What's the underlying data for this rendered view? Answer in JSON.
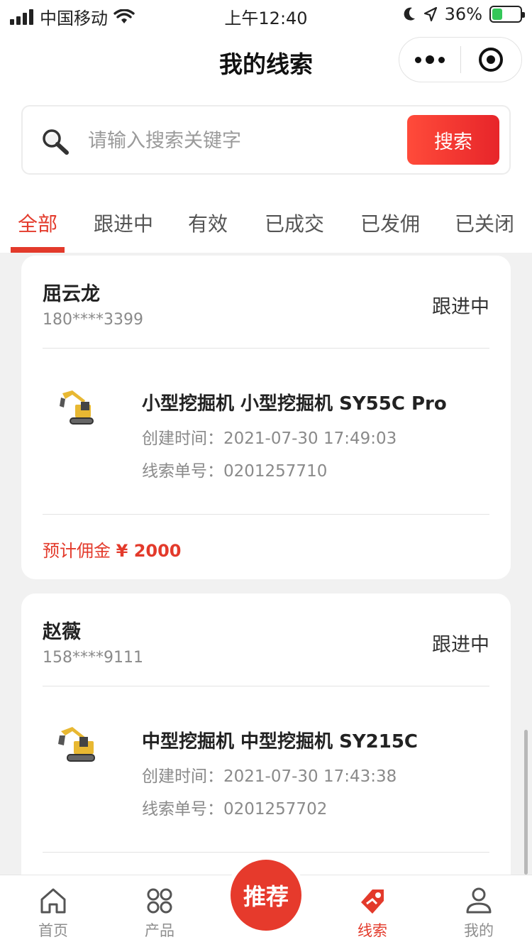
{
  "status_bar": {
    "carrier": "中国移动",
    "time": "上午12:40",
    "battery": "36%",
    "battery_level": 0.36
  },
  "nav": {
    "title": "我的线索"
  },
  "search": {
    "placeholder": "请输入搜索关键字",
    "value": "",
    "button": "搜索"
  },
  "tabs": [
    {
      "label": "全部",
      "active": true
    },
    {
      "label": "跟进中",
      "active": false
    },
    {
      "label": "有效",
      "active": false
    },
    {
      "label": "已成交",
      "active": false
    },
    {
      "label": "已发佣",
      "active": false
    },
    {
      "label": "已关闭",
      "active": false
    }
  ],
  "leads": [
    {
      "name": "屈云龙",
      "phone": "180****3399",
      "status": "跟进中",
      "product": "小型挖掘机 小型挖掘机 SY55C Pro",
      "created_label": "创建时间：",
      "created": "2021-07-30 17:49:03",
      "order_label": "线索单号：",
      "order_no": "0201257710",
      "commission_label": "预计佣金",
      "commission": "¥ 2000"
    },
    {
      "name": "赵薇",
      "phone": "158****9111",
      "status": "跟进中",
      "product": "中型挖掘机 中型挖掘机 SY215C",
      "created_label": "创建时间：",
      "created": "2021-07-30 17:43:38",
      "order_label": "线索单号：",
      "order_no": "0201257702"
    }
  ],
  "tabbar": {
    "items": [
      {
        "label": "首页",
        "icon": "home-icon"
      },
      {
        "label": "产品",
        "icon": "product-grid-icon"
      },
      {
        "label": "线索",
        "icon": "lead-tag-icon",
        "active": true
      },
      {
        "label": "我的",
        "icon": "user-icon"
      }
    ],
    "center": "推荐"
  },
  "colors": {
    "accent": "#e33a2b",
    "background": "#f1f1f1"
  }
}
